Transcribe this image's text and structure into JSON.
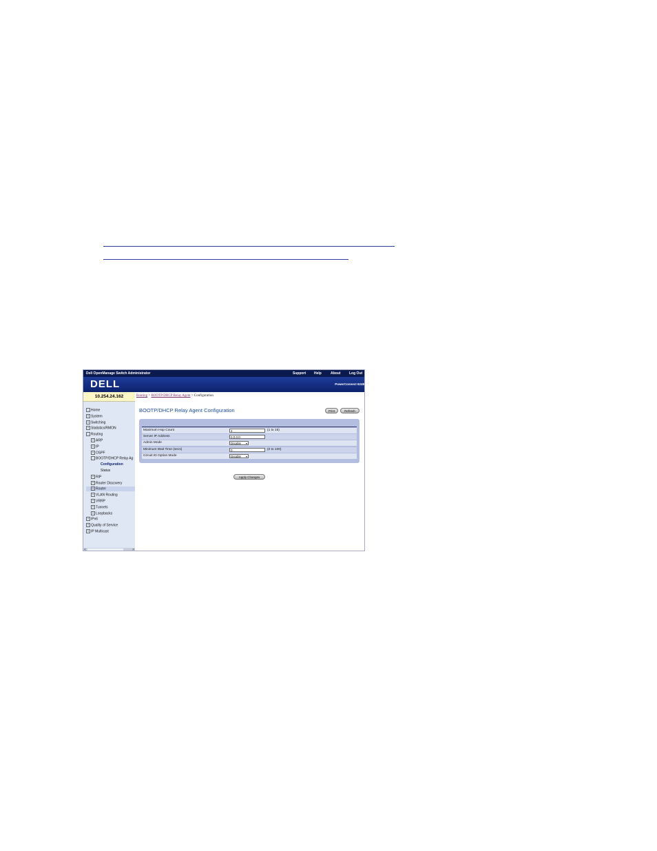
{
  "window": {
    "app_title": "Dell OpenManage Switch Administrator",
    "links": [
      "Support",
      "Help",
      "About",
      "Log Out"
    ],
    "logo": "DELL",
    "product": "PowerConnect 6248"
  },
  "ip_address": "10.254.24.162",
  "breadcrumb": {
    "routing": "Routing",
    "sep1": " > ",
    "relay": "BOOTP/DHCP Relay Agent",
    "sep2": " > ",
    "current": "Configuration"
  },
  "sidebar": {
    "items": [
      {
        "label": "Home",
        "level": 0,
        "expander": "-"
      },
      {
        "label": "System",
        "level": 0,
        "expander": "+"
      },
      {
        "label": "Switching",
        "level": 0,
        "expander": "+"
      },
      {
        "label": "Statistics/RMON",
        "level": 0,
        "expander": "+"
      },
      {
        "label": "Routing",
        "level": 0,
        "expander": "-"
      },
      {
        "label": "ARP",
        "level": 1,
        "expander": "+"
      },
      {
        "label": "IP",
        "level": 1,
        "expander": "+"
      },
      {
        "label": "OSPF",
        "level": 1,
        "expander": "+"
      },
      {
        "label": "BOOTP/DHCP Relay Ag",
        "level": 1,
        "expander": "-"
      },
      {
        "label": "Configuration",
        "level": 2,
        "expander": ""
      },
      {
        "label": "Status",
        "level": 2,
        "expander": ""
      },
      {
        "label": "RIP",
        "level": 1,
        "expander": "+"
      },
      {
        "label": "Router Discovery",
        "level": 1,
        "expander": "+"
      },
      {
        "label": "Router",
        "level": 1,
        "expander": "+"
      },
      {
        "label": "VLAN Routing",
        "level": 1,
        "expander": "+"
      },
      {
        "label": "VRRP",
        "level": 1,
        "expander": "+"
      },
      {
        "label": "Tunnels",
        "level": 1,
        "expander": "+"
      },
      {
        "label": "Loopbacks",
        "level": 1,
        "expander": "+"
      },
      {
        "label": "IPv6",
        "level": 0,
        "expander": "+"
      },
      {
        "label": "Quality of Service",
        "level": 0,
        "expander": "+"
      },
      {
        "label": "IP Multicast",
        "level": 0,
        "expander": "+"
      }
    ],
    "scroll_left": "<",
    "scroll_right": ">"
  },
  "page": {
    "title": "BOOTP/DHCP Relay Agent Configuration",
    "print_label": "Print",
    "refresh_label": "Refresh",
    "apply_label": "Apply Changes"
  },
  "form": {
    "rows": [
      {
        "label": "Maximum Hop Count",
        "value": "4",
        "range": "(1 to 16)"
      },
      {
        "label": "Server IP Address",
        "value": "0.0.0.0",
        "range": ""
      },
      {
        "label": "Admin Mode",
        "value": "Disable",
        "range": ""
      },
      {
        "label": "Minimum Wait Time (secs)",
        "value": "0",
        "range": "(0 to 100)"
      },
      {
        "label": "Circuit ID Option Mode",
        "value": "Disable",
        "range": ""
      }
    ]
  }
}
